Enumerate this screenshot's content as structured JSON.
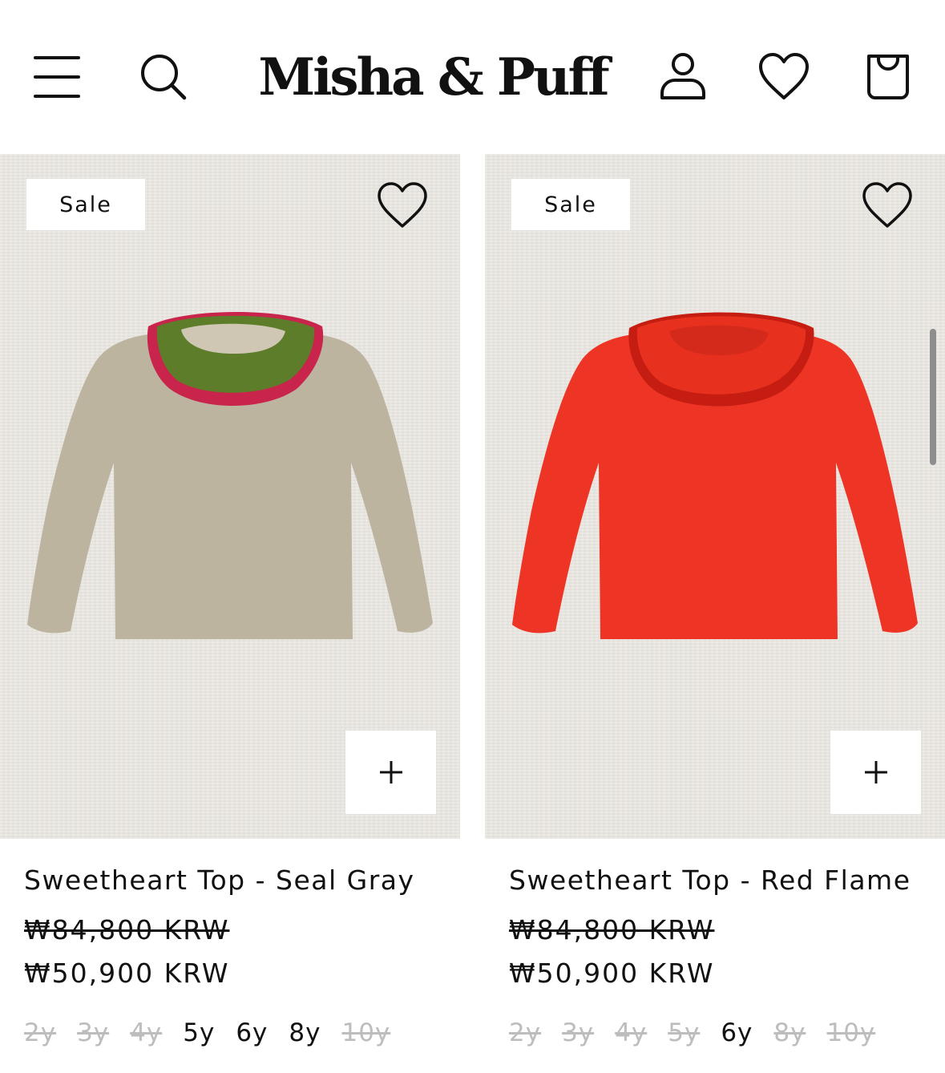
{
  "header": {
    "brand": "Misha & Puff",
    "icons": [
      "menu-icon",
      "search-icon",
      "account-icon",
      "wishlist-icon",
      "cart-icon"
    ]
  },
  "products": [
    {
      "badge": "Sale",
      "title": "Sweetheart Top - Seal Gray",
      "original_price": "₩84,800 KRW",
      "sale_price": "₩50,900 KRW",
      "body_color": "#bdb4a0",
      "collar_color": "#5d7d2b",
      "trim_color": "#c9244b",
      "sizes": [
        {
          "label": "2y",
          "available": false
        },
        {
          "label": "3y",
          "available": false
        },
        {
          "label": "4y",
          "available": false
        },
        {
          "label": "5y",
          "available": true
        },
        {
          "label": "6y",
          "available": true
        },
        {
          "label": "8y",
          "available": true
        },
        {
          "label": "10y",
          "available": false
        }
      ]
    },
    {
      "badge": "Sale",
      "title": "Sweetheart Top - Red Flame",
      "original_price": "₩84,800 KRW",
      "sale_price": "₩50,900 KRW",
      "body_color": "#ee3424",
      "collar_color": "#e8301f",
      "trim_color": "#c51d12",
      "sizes": [
        {
          "label": "2y",
          "available": false
        },
        {
          "label": "3y",
          "available": false
        },
        {
          "label": "4y",
          "available": false
        },
        {
          "label": "5y",
          "available": false
        },
        {
          "label": "6y",
          "available": true
        },
        {
          "label": "8y",
          "available": false
        },
        {
          "label": "10y",
          "available": false
        }
      ]
    }
  ]
}
